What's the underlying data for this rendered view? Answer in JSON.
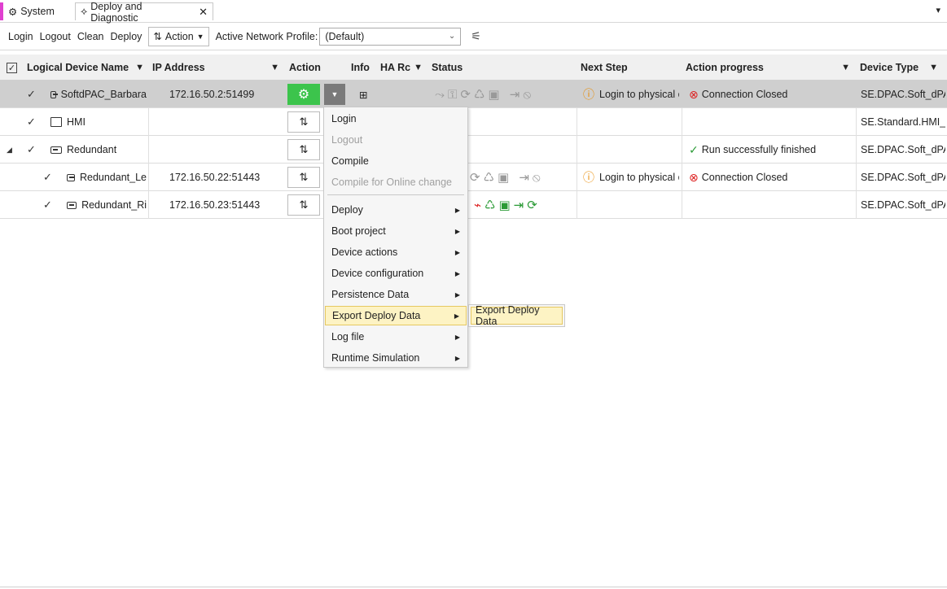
{
  "tabs": [
    {
      "label": "System",
      "icon": "system-icon"
    },
    {
      "label": "Deploy and Diagnostic",
      "icon": "deploy-icon",
      "close": "✕"
    }
  ],
  "toolbar": {
    "login": "Login",
    "logout": "Logout",
    "clean": "Clean",
    "deploy": "Deploy",
    "action_label": "Action",
    "profile_label": "Active Network Profile:",
    "profile_value": "(Default)"
  },
  "columns": {
    "name": "Logical Device Name",
    "ip": "IP Address",
    "action": "Action",
    "info": "Info",
    "ha": "HA Rc",
    "status": "Status",
    "next": "Next Step",
    "progress": "Action progress",
    "type": "Device Type"
  },
  "rows": [
    {
      "name": "SoftdPAC_Barbara",
      "ip": "172.16.50.2:51499",
      "next": "Login to physical c",
      "progress": "Connection Closed",
      "type": "SE.DPAC.Soft_dPAC"
    },
    {
      "name": "HMI",
      "ip": "",
      "next": "",
      "progress": "",
      "type": "SE.Standard.HMI_N"
    },
    {
      "name": "Redundant",
      "ip": "",
      "next": "",
      "progress": "Run successfully finished",
      "type": "SE.DPAC.Soft_dPAC"
    },
    {
      "name": "Redundant_Le",
      "ip": "172.16.50.22:51443",
      "next": "Login to physical c",
      "progress": "Connection Closed",
      "type": "SE.DPAC.Soft_dPAC"
    },
    {
      "name": "Redundant_Ri",
      "ip": "172.16.50.23:51443",
      "next": "",
      "progress": "",
      "type": "SE.DPAC.Soft_dPAC"
    }
  ],
  "menu": {
    "items": [
      {
        "label": "Login",
        "disabled": false
      },
      {
        "label": "Logout",
        "disabled": true
      },
      {
        "label": "Compile",
        "disabled": false
      },
      {
        "label": "Compile for Online change",
        "disabled": true
      },
      {
        "label": "Deploy"
      },
      {
        "label": "Boot project"
      },
      {
        "label": "Device actions"
      },
      {
        "label": "Device configuration"
      },
      {
        "label": "Persistence Data"
      },
      {
        "label": "Export Deploy Data"
      },
      {
        "label": "Log file"
      },
      {
        "label": "Runtime Simulation"
      }
    ],
    "submenu_item": "Export Deploy Data"
  }
}
